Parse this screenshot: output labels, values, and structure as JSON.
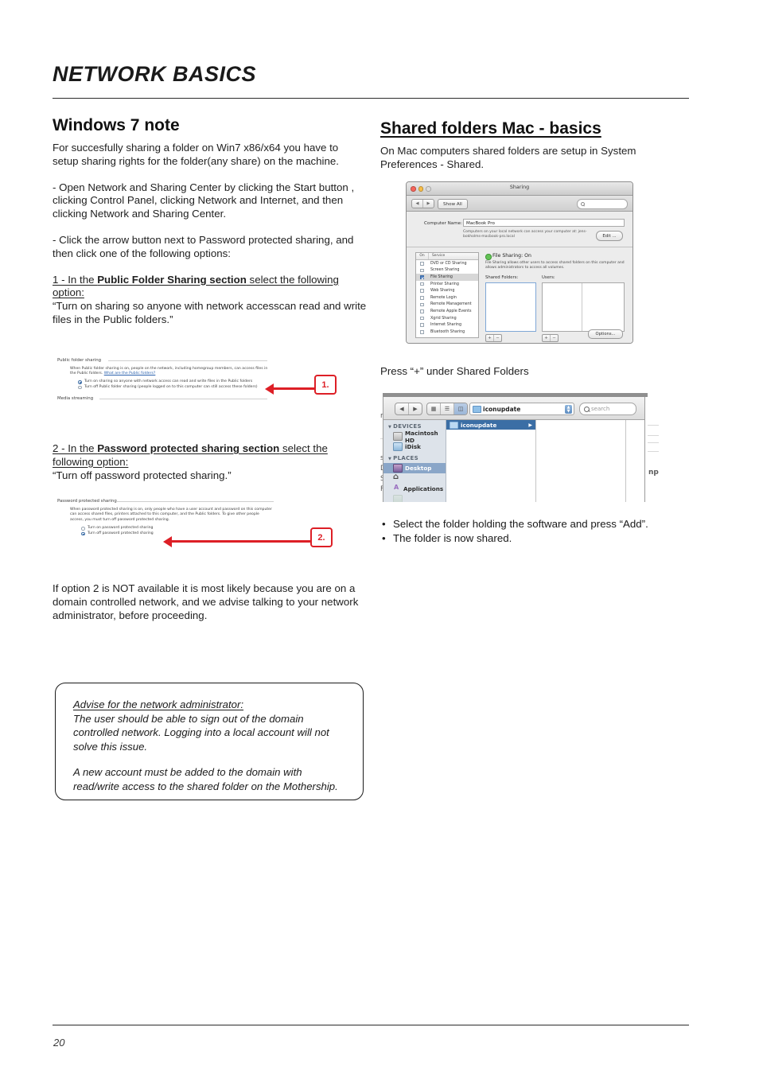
{
  "document": {
    "header_title": "NETWORK BASICS",
    "page_number": "20"
  },
  "left_column": {
    "heading": "Windows 7 note",
    "paragraphs": [
      "For succesfully sharing a folder on Win7 x86/x64 you have to setup sharing rights for the folder(any share) on the machine.",
      "-  Open Network and Sharing Center by clicking the Start button , clicking Control Panel, clicking Network and Internet, and then clicking Network and Sharing Center.",
      "-  Click the arrow button  next to Password protected sharing, and then click one of the following options:"
    ],
    "step1": {
      "prefix": "1 - In the ",
      "bold": "Public Folder Sharing section",
      "suffix": " select the following option:",
      "quote": "“Turn on sharing so anyone with network accesscan read and write files in the Public folders.”"
    },
    "step2": {
      "prefix": "2 - In the ",
      "bold": "Password protected sharing section",
      "suffix": " select the following option:",
      "quote": "“Turn off password protected sharing.”"
    },
    "closing_paragraph": "If option 2 is NOT available it is most likely because you are on a domain controlled network, and we advise talking to your network administrator, before proceeding.",
    "advise_box": {
      "title": "Advise for the network administrator:",
      "paragraph1": "The user should be able to sign out of the domain controlled network. Logging into a local account will not solve this issue.",
      "paragraph2": "A new account must be added to the domain with read/write access to the shared folder on the Mothership."
    }
  },
  "windows_shot_public": {
    "section_label": "Public folder sharing",
    "description_before_link": "When Public folder sharing is on, people on the network, including homegroup members, can access files in the Public folders. ",
    "link_text": "What are the Public folders?",
    "option_on": "Turn on sharing so anyone with network access can read and write files in the Public folders",
    "option_off": "Turn off Public folder sharing (people logged on to this computer can still access these folders)",
    "second_section_label": "Media streaming",
    "callout_number": "1."
  },
  "windows_shot_password": {
    "section_label": "Password protected sharing",
    "description": "When password protected sharing is on, only people who have a user account and password on this computer can access shared files, printers attached to this computer, and the Public folders. To give other people access, you must turn off password protected sharing.",
    "option_on": "Turn on password protected sharing",
    "option_off": "Turn off password protected sharing",
    "callout_number": "2."
  },
  "right_column": {
    "heading": "Shared folders Mac - basics",
    "intro": "On Mac computers shared folders are setup in System Preferences - Shared.",
    "press_plus": "Press “+” under Shared Folders",
    "bullets": [
      "Select the folder holding the software and press “Add”.",
      "The folder is now shared."
    ]
  },
  "mac_sharing_window": {
    "window_title": "Sharing",
    "show_all_button": "Show All",
    "search_placeholder": "",
    "computer_name_label": "Computer Name:",
    "computer_name_value": "MacBook Pro",
    "computer_name_hint": "Computers on your local network can access your computer at: jens-bokholms-macbook-pro.local",
    "edit_button": "Edit ...",
    "table_headers": {
      "on": "On",
      "service": "Service"
    },
    "services": [
      {
        "name": "DVD or CD Sharing",
        "checked": false,
        "selected": false
      },
      {
        "name": "Screen Sharing",
        "checked": false,
        "selected": false
      },
      {
        "name": "File Sharing",
        "checked": true,
        "selected": true
      },
      {
        "name": "Printer Sharing",
        "checked": false,
        "selected": false
      },
      {
        "name": "Web Sharing",
        "checked": false,
        "selected": false
      },
      {
        "name": "Remote Login",
        "checked": false,
        "selected": false
      },
      {
        "name": "Remote Management",
        "checked": false,
        "selected": false
      },
      {
        "name": "Remote Apple Events",
        "checked": false,
        "selected": false
      },
      {
        "name": "Xgrid Sharing",
        "checked": false,
        "selected": false
      },
      {
        "name": "Internet Sharing",
        "checked": false,
        "selected": false
      },
      {
        "name": "Bluetooth Sharing",
        "checked": false,
        "selected": false
      }
    ],
    "status_title": "File Sharing: On",
    "status_description": "File Sharing allows other users to access shared folders on this computer and allows administrators to access all volumes.",
    "shared_folders_label": "Shared Folders:",
    "users_label": "Users:",
    "add_button": "+",
    "remove_button": "−",
    "options_button": "Options..."
  },
  "finder_window": {
    "path_value": "iconupdate",
    "search_placeholder": "search",
    "sidebar": [
      {
        "type": "header",
        "label": "DEVICES"
      },
      {
        "type": "item",
        "label": "Macintosh HD",
        "icon": "harddisk-icon",
        "selected": false
      },
      {
        "type": "item",
        "label": "iDisk",
        "icon": "idisk-icon",
        "selected": false
      },
      {
        "type": "header",
        "label": "PLACES"
      },
      {
        "type": "item",
        "label": "Desktop",
        "icon": "desktop-icon",
        "selected": true
      },
      {
        "type": "item",
        "label": "",
        "icon": "home-icon",
        "selected": false
      },
      {
        "type": "item",
        "label": "Applications",
        "icon": "applications-icon",
        "selected": false
      }
    ],
    "selected_folder": "iconupdate",
    "background_fragments": [
      "m",
      "s",
      "D",
      "S",
      "F",
      "np"
    ]
  },
  "colors": {
    "accent_red": "#dd1f26",
    "link_blue": "#2b62ad",
    "finder_selection": "#3b6ea5",
    "status_green": "#63c256"
  }
}
